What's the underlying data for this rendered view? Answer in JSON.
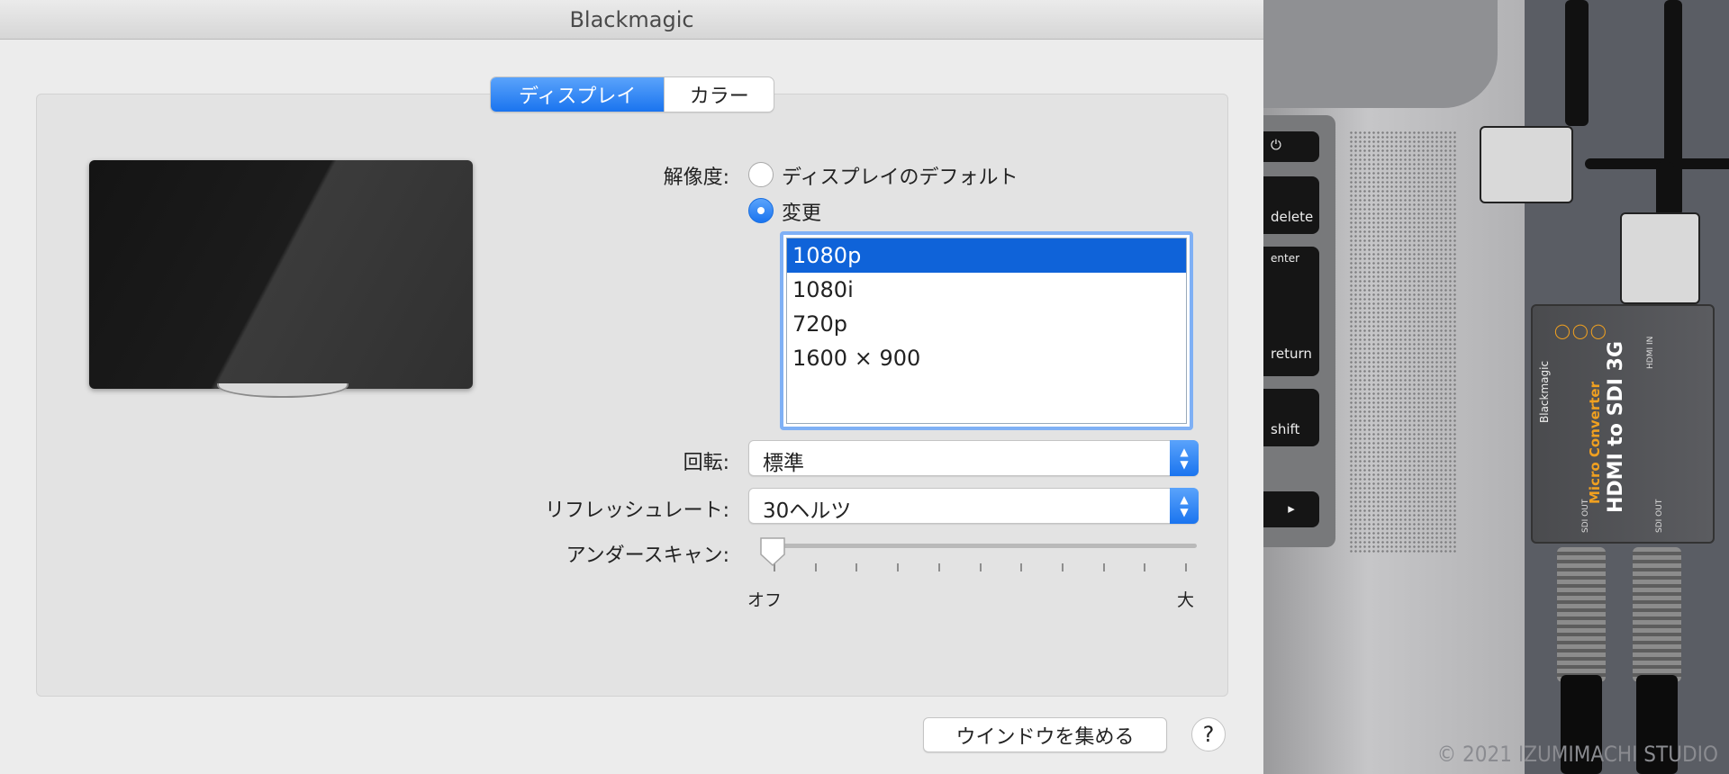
{
  "window": {
    "title": "Blackmagic"
  },
  "tabs": [
    {
      "label": "ディスプレイ",
      "active": true
    },
    {
      "label": "カラー",
      "active": false
    }
  ],
  "resolution": {
    "label": "解像度:",
    "options": [
      {
        "label": "ディスプレイのデフォルト",
        "selected": false
      },
      {
        "label": "変更",
        "selected": true
      }
    ],
    "list": [
      "1080p",
      "1080i",
      "720p",
      "1600 × 900"
    ],
    "selected_item": "1080p"
  },
  "rotation": {
    "label": "回転:",
    "value": "標準"
  },
  "refresh_rate": {
    "label": "リフレッシュレート:",
    "value": "30ヘルツ"
  },
  "underscan": {
    "label": "アンダースキャン:",
    "min_label": "オフ",
    "max_label": "大",
    "level": 0,
    "ticks": 11
  },
  "buttons": {
    "gather_windows": "ウインドウを集める",
    "help": "?"
  },
  "photo": {
    "keys": [
      "delete",
      "enter",
      "return",
      "shift",
      "▸"
    ],
    "device_brand": "Blackmagic",
    "device_name_line1": "Micro Converter",
    "device_name_line2": "HDMI to SDI 3G",
    "port_label_hdmi": "HDMI IN",
    "port_label_sdi": "SDI OUT",
    "copyright": "© 2021 IZUMIMACHI STUDIO"
  },
  "colors": {
    "accent": "#1a74ef",
    "selection": "#0f63d9",
    "focus_ring": "#7fb0f5",
    "device_label_orange": "#f0a020"
  }
}
